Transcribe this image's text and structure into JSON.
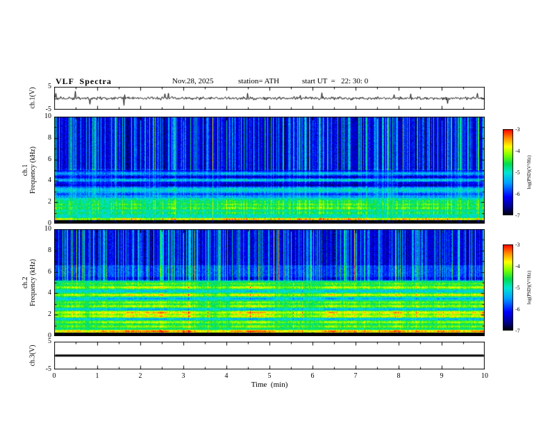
{
  "header": {
    "title": "VLF  Spectra",
    "date": "Nov.28, 2025",
    "station": "station= ATH",
    "start_ut": "start UT  =   22: 30: 0"
  },
  "colors": {
    "background": "#ffffff",
    "frame": "#000000",
    "trace": "#000000",
    "colormap_stops": [
      [
        0.0,
        [
          0,
          0,
          0
        ]
      ],
      [
        0.1,
        [
          0,
          0,
          140
        ]
      ],
      [
        0.22,
        [
          0,
          0,
          255
        ]
      ],
      [
        0.38,
        [
          0,
          160,
          255
        ]
      ],
      [
        0.5,
        [
          0,
          230,
          210
        ]
      ],
      [
        0.6,
        [
          0,
          220,
          80
        ]
      ],
      [
        0.7,
        [
          120,
          255,
          0
        ]
      ],
      [
        0.8,
        [
          255,
          255,
          0
        ]
      ],
      [
        0.9,
        [
          255,
          140,
          0
        ]
      ],
      [
        1.0,
        [
          255,
          0,
          0
        ]
      ]
    ]
  },
  "chart_data": {
    "type": "heatmap",
    "title": "VLF  Spectra",
    "subtitle": "Nov.28, 2025  station= ATH  start UT = 22:30:0",
    "time_axis": {
      "label": "Time  (min)",
      "range_min": [
        0,
        10
      ],
      "ticks": [
        0,
        1,
        2,
        3,
        4,
        5,
        6,
        7,
        8,
        9,
        10
      ]
    },
    "colorbar": {
      "label": "log(PSD)(V²/Hz)",
      "range": [
        -7,
        -3
      ],
      "ticks": [
        -3,
        -4,
        -5,
        -6,
        -7
      ]
    },
    "panels": [
      {
        "id": "ch1_waveform",
        "type": "line",
        "ylabel": "ch.1(V)",
        "ylim": [
          -5,
          5
        ],
        "yticks": [
          5,
          -5
        ],
        "signal": {
          "baseline_v": 0,
          "noise_amplitude_v": 0.55,
          "spike_rate": 0.035,
          "spike_amplitude_v": 2.2,
          "flat": false
        }
      },
      {
        "id": "ch1_spectrogram",
        "type": "heatmap",
        "ylabel": [
          "ch.1",
          "Frequency  (kHz)"
        ],
        "ylim": [
          0,
          10
        ],
        "yticks": [
          10,
          8,
          6,
          4,
          2,
          0
        ],
        "psd_bands": [
          [
            0.0,
            0.3,
            -7.2
          ],
          [
            0.3,
            0.55,
            -4.8
          ],
          [
            0.55,
            2.4,
            -5.1
          ],
          [
            2.4,
            3.3,
            -5.5
          ],
          [
            3.3,
            5.1,
            -5.9
          ],
          [
            5.1,
            10.0,
            -6.35
          ]
        ],
        "psd_lines": [
          [
            0.42,
            0.9,
            0.08
          ],
          [
            1.0,
            0.4,
            0.1
          ],
          [
            1.45,
            0.55,
            0.12
          ],
          [
            1.8,
            0.5,
            0.1
          ],
          [
            2.1,
            0.35,
            0.1
          ],
          [
            2.75,
            -0.4,
            0.08
          ],
          [
            3.1,
            0.3,
            0.08
          ],
          [
            3.35,
            0.3,
            0.07
          ],
          [
            3.6,
            -0.5,
            0.1
          ],
          [
            3.85,
            -0.35,
            0.07
          ],
          [
            4.05,
            0.55,
            0.1
          ],
          [
            4.35,
            -0.45,
            0.08
          ],
          [
            4.7,
            0.4,
            0.09
          ],
          [
            5.0,
            -0.3,
            0.1
          ]
        ],
        "sferic_streaks": {
          "density": 0.6,
          "strength": 1.7,
          "fmin_khz": 5.0,
          "low_factor": 0.3
        }
      },
      {
        "id": "ch2_spectrogram",
        "type": "heatmap",
        "ylabel": [
          "ch.2",
          "Frequency  (kHz)"
        ],
        "ylim": [
          0,
          10
        ],
        "yticks": [
          10,
          8,
          6,
          4,
          2,
          0
        ],
        "psd_bands": [
          [
            0.0,
            0.3,
            -7.2
          ],
          [
            0.3,
            0.6,
            -4.4
          ],
          [
            0.6,
            5.2,
            -4.85
          ],
          [
            5.2,
            6.6,
            -5.9
          ],
          [
            6.6,
            10.0,
            -6.3
          ]
        ],
        "psd_lines": [
          [
            0.45,
            0.8,
            0.09
          ],
          [
            0.9,
            0.5,
            0.1
          ],
          [
            1.3,
            0.6,
            0.1
          ],
          [
            1.6,
            -0.5,
            0.07
          ],
          [
            1.85,
            0.8,
            0.1
          ],
          [
            2.2,
            0.9,
            0.12
          ],
          [
            2.5,
            -0.5,
            0.07
          ],
          [
            2.8,
            0.6,
            0.1
          ],
          [
            3.15,
            0.5,
            0.09
          ],
          [
            3.5,
            -0.5,
            0.08
          ],
          [
            3.85,
            0.8,
            0.1
          ],
          [
            4.2,
            -0.4,
            0.07
          ],
          [
            4.55,
            0.7,
            0.1
          ],
          [
            4.9,
            0.4,
            0.09
          ],
          [
            5.4,
            -0.3,
            0.1
          ]
        ],
        "sferic_streaks": {
          "density": 0.55,
          "strength": 1.7,
          "fmin_khz": 5.2,
          "low_factor": 0.12
        }
      },
      {
        "id": "ch3_waveform",
        "type": "line",
        "ylabel": "ch.3(V)",
        "ylim": [
          -5,
          5
        ],
        "yticks": [
          5,
          -5
        ],
        "signal": {
          "baseline_v": 0,
          "noise_amplitude_v": 0,
          "spike_rate": 0,
          "spike_amplitude_v": 0,
          "flat": true
        }
      }
    ]
  }
}
